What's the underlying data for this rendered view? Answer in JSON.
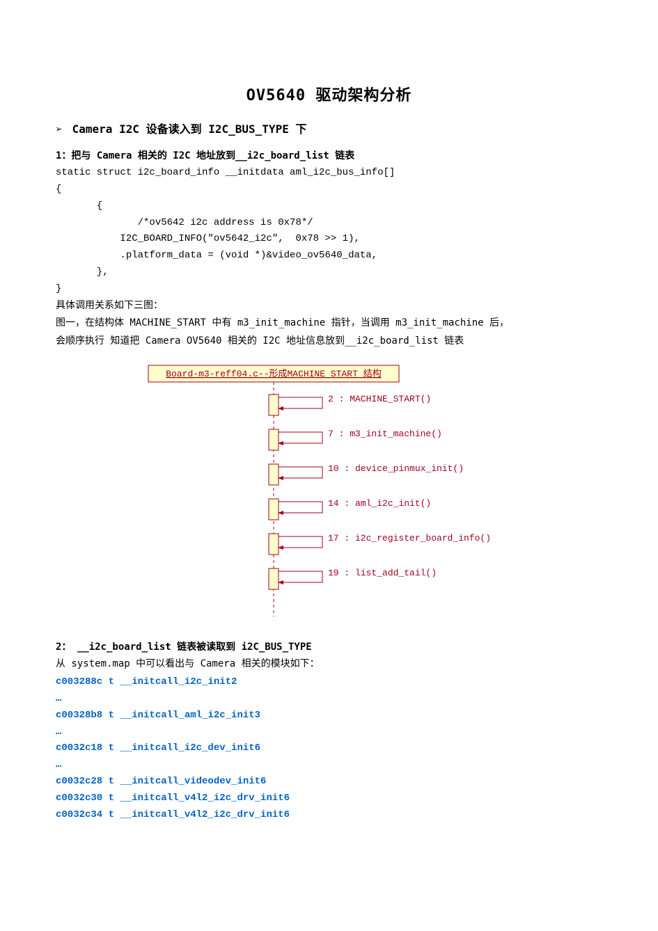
{
  "title": "OV5640 驱动架构分析",
  "bullet1": "Camera I2C 设备读入到 I2C_BUS_TYPE 下",
  "section1": {
    "head": "1：把与 Camera 相关的 I2C 地址放到__i2c_board_list 链表",
    "code": "static struct i2c_board_info __initdata aml_i2c_bus_info[]\n{\n       {\n              /*ov5642 i2c address is 0x78*/\n           I2C_BOARD_INFO(\"ov5642_i2c\",  0x78 >> 1),\n           .platform_data = (void *)&video_ov5640_data,\n       },\n}",
    "p1": "具体调用关系如下三图：",
    "p2a": "图一，在结构体 MACHINE_START 中有 m3_init_machine 指针，当调用 m3_init_machine 后，",
    "p2b": "会顺序执行 知道把 Camera OV5640 相关的 I2C 地址信息放到__i2c_board_list 链表"
  },
  "diagram": {
    "lifeline": "Board-m3-reff04.c--形成MACHINE_START 结构",
    "msgs": [
      "2 : MACHINE_START()",
      "7 : m3_init_machine()",
      "10 : device_pinmux_init()",
      "14 : aml_i2c_init()",
      "17 : i2c_register_board_info()",
      "19 : list_add_tail()"
    ]
  },
  "section2": {
    "head": "2： __i2c_board_list 链表被读取到 i2C_BUS_TYPE",
    "p1": "从 system.map 中可以看出与 Camera 相关的模块如下：",
    "lines": [
      "c003288c t __initcall_i2c_init2",
      "…",
      "c00328b8 t __initcall_aml_i2c_init3",
      "…",
      "c0032c18 t __initcall_i2c_dev_init6",
      "…",
      "c0032c28 t __initcall_videodev_init6",
      "c0032c30 t __initcall_v4l2_i2c_drv_init6",
      "c0032c34 t __initcall_v4l2_i2c_drv_init6"
    ]
  }
}
